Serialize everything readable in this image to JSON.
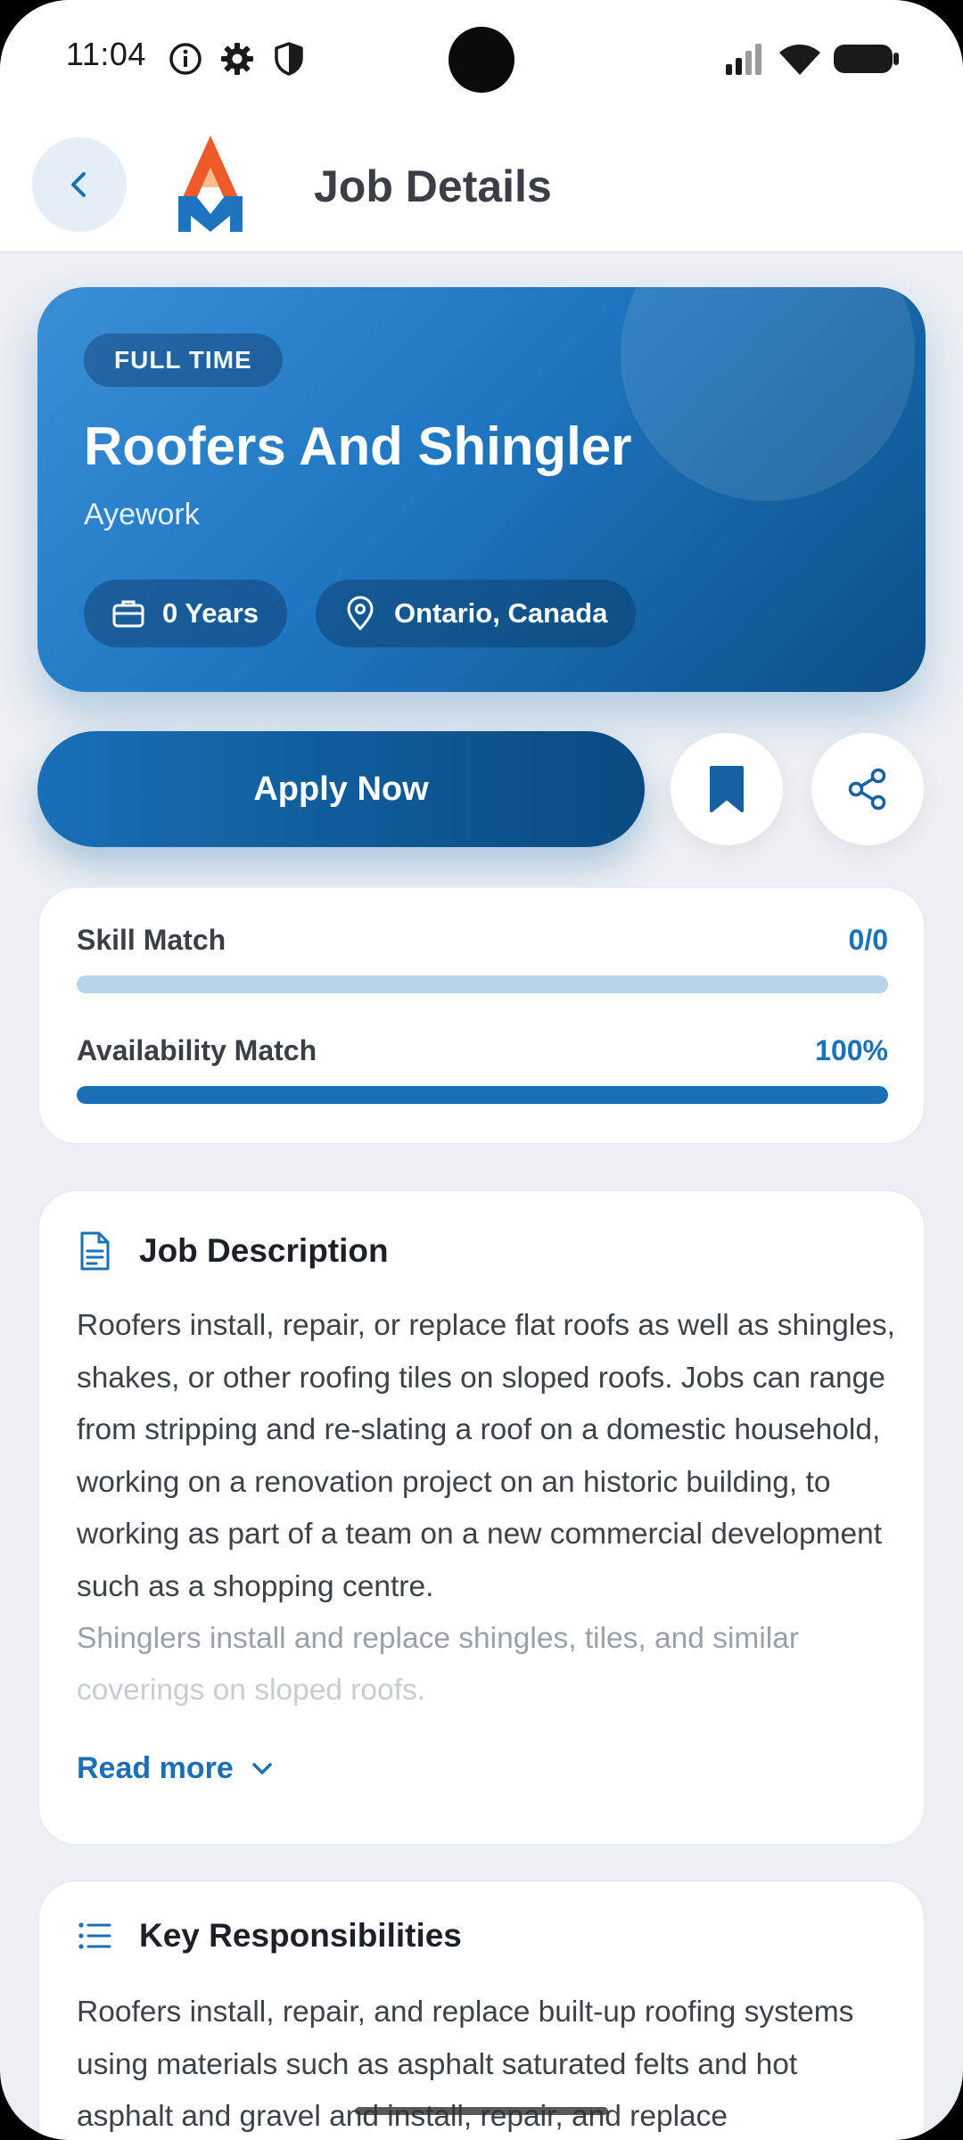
{
  "status_bar": {
    "time": "11:04",
    "icons_left": [
      "info-icon",
      "gear-icon",
      "shield-icon"
    ],
    "icons_right": [
      "signal-icon",
      "wifi-icon",
      "battery-icon"
    ]
  },
  "header": {
    "title": "Job Details",
    "back_icon": "chevron-left-icon",
    "logo": "app-logo"
  },
  "job": {
    "type_badge": "FULL TIME",
    "title": "Roofers And Shingler",
    "company": "Ayework",
    "experience": "0 Years",
    "location": "Ontario, Canada"
  },
  "actions": {
    "apply_label": "Apply Now",
    "bookmark_icon": "bookmark-icon",
    "share_icon": "share-icon"
  },
  "match": [
    {
      "label": "Skill Match",
      "value": "0/0",
      "fraction": 0
    },
    {
      "label": "Availability Match",
      "value": "100%",
      "fraction": 1
    }
  ],
  "description": {
    "title": "Job Description",
    "icon": "document-icon",
    "text": "Roofers install, repair, or replace flat roofs as well as shingles, shakes, or other roofing tiles on sloped roofs. Jobs can range from stripping and re-slating a roof on a domestic household, working on a renovation project on an historic building, to working as part of a team on a new commercial development such as a shopping centre.",
    "text_faded_1": "Shinglers install and replace shingles, tiles, and similar",
    "text_faded_2": "coverings on sloped roofs.",
    "read_more": "Read more"
  },
  "responsibilities": {
    "title": "Key Responsibilities",
    "icon": "list-icon",
    "text": "Roofers install, repair, and replace built-up roofing systems using materials such as asphalt saturated felts and hot asphalt and gravel and install, repair, and replace"
  },
  "colors": {
    "accent": "#1b72b8",
    "hero_start": "#3a8fd6",
    "hero_end": "#0b4f86",
    "background": "#eceff3"
  }
}
